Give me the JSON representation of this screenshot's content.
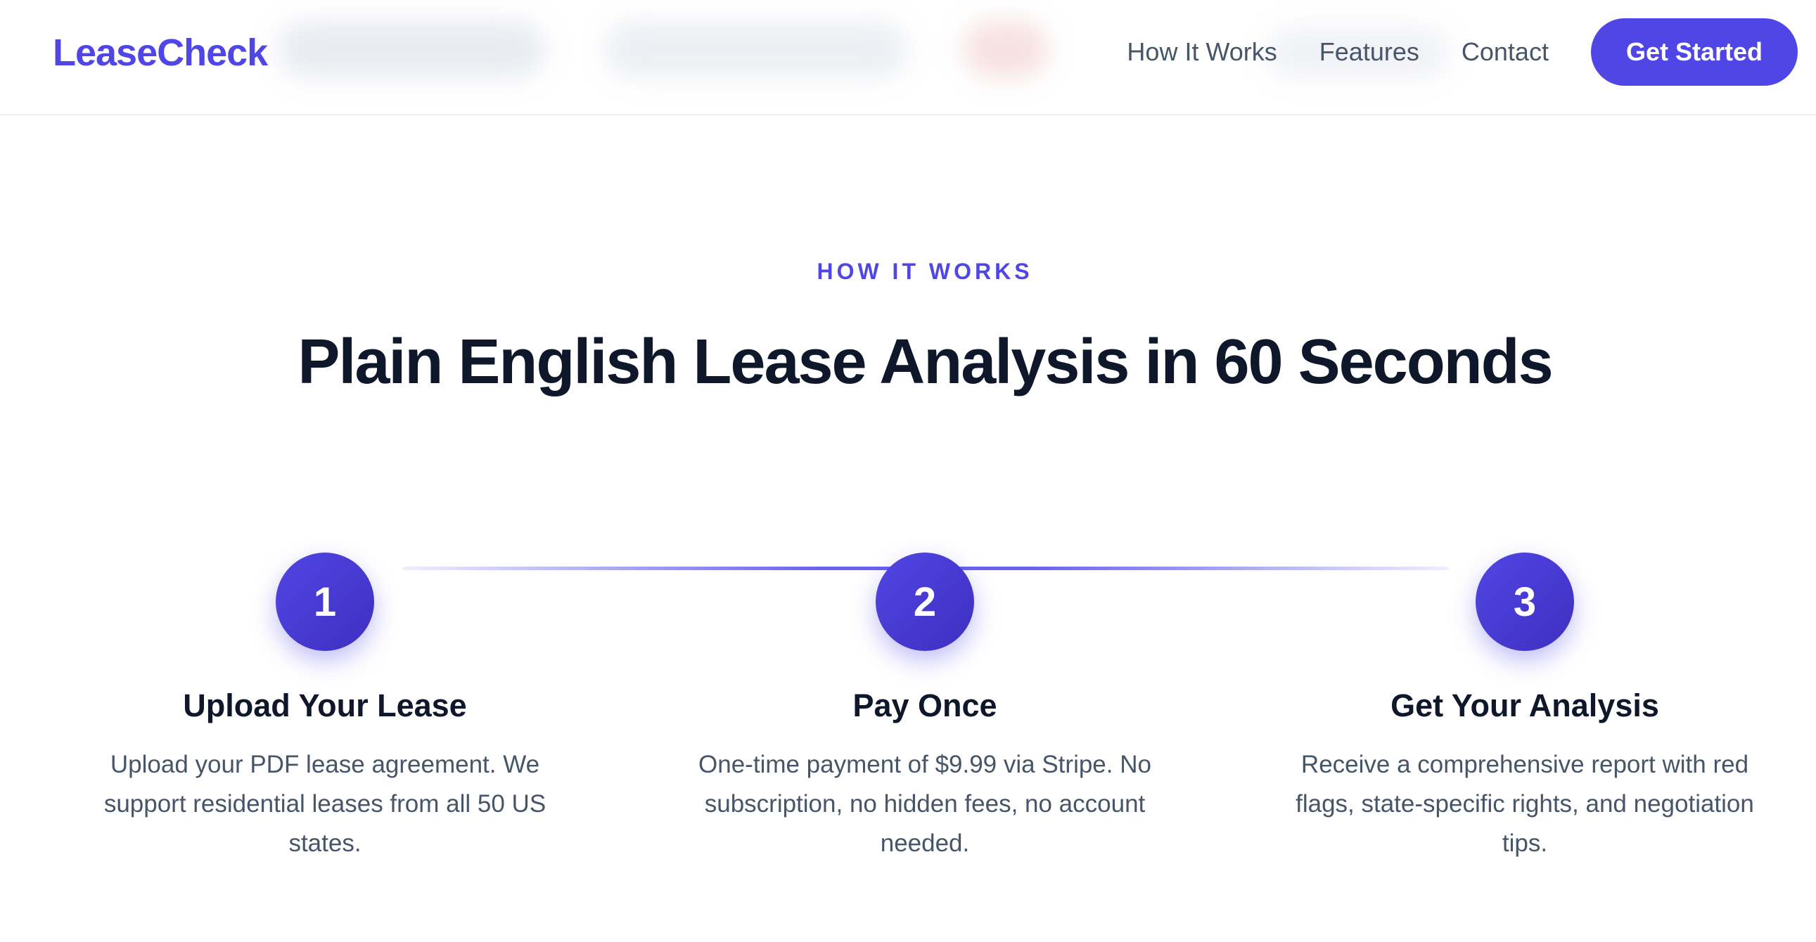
{
  "brand": {
    "name": "LeaseCheck",
    "accent": "#4f46e5"
  },
  "nav": {
    "links": [
      "How It Works",
      "Features",
      "Contact"
    ],
    "cta_label": "Get Started"
  },
  "section": {
    "eyebrow": "HOW IT WORKS",
    "headline": "Plain English Lease Analysis in 60 Seconds"
  },
  "steps": [
    {
      "number": "1",
      "title": "Upload Your Lease",
      "description": "Upload your PDF lease agreement. We support residential leases from all 50 US states."
    },
    {
      "number": "2",
      "title": "Pay Once",
      "description": "One-time payment of $9.99 via Stripe. No subscription, no hidden fees, no account needed."
    },
    {
      "number": "3",
      "title": "Get Your Analysis",
      "description": "Receive a comprehensive report with red flags, state-specific rights, and negotiation tips."
    }
  ]
}
